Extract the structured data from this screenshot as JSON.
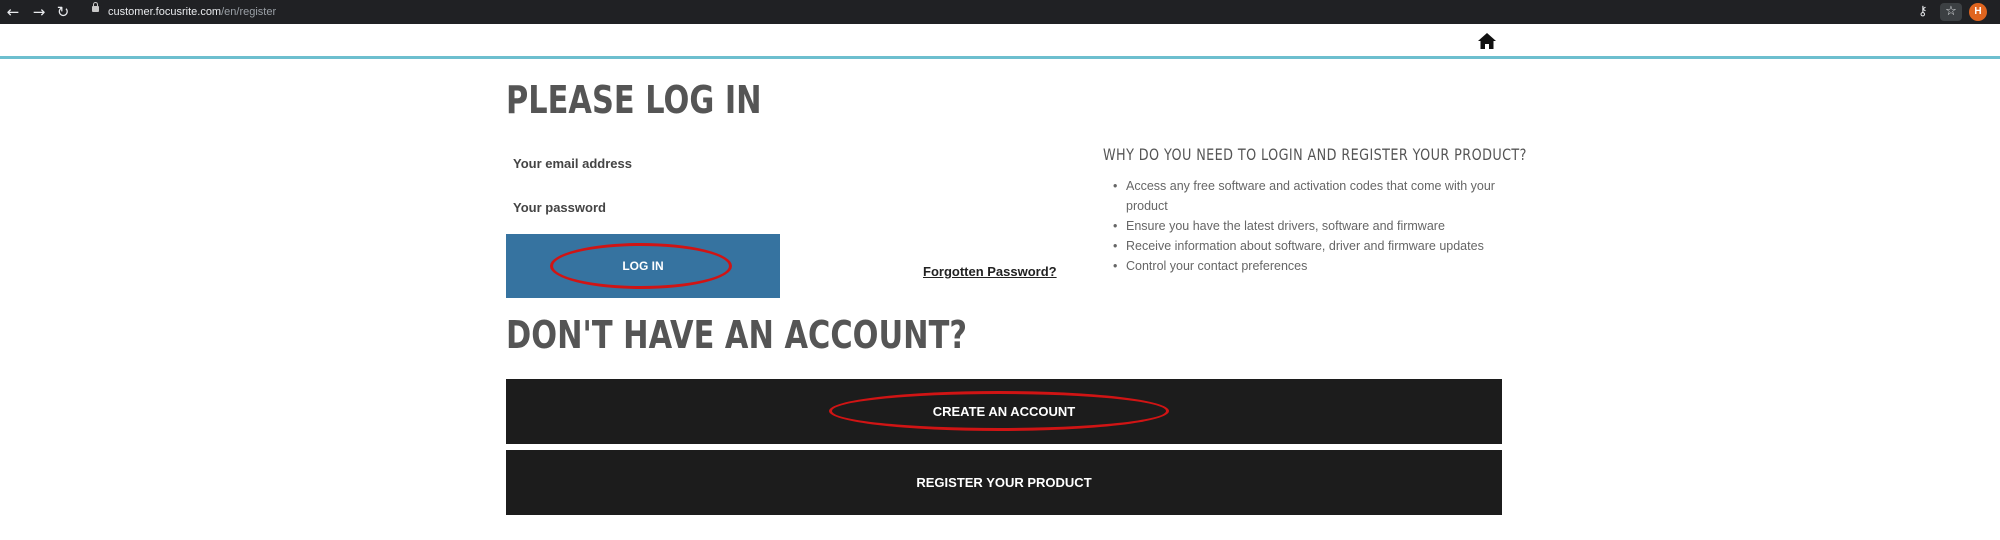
{
  "browser": {
    "url_host": "customer.focusrite.com",
    "url_path": "/en/register",
    "avatar_initial": "H",
    "icons": [
      "back-arrow-icon",
      "forward-arrow-icon",
      "reload-icon",
      "lock-icon",
      "key-icon",
      "star-icon"
    ]
  },
  "header": {
    "home_icon": "home-icon",
    "accent_color": "#6dbfcf"
  },
  "login": {
    "title": "PLEASE LOG IN",
    "email_label": "Your email address",
    "password_label": "Your password",
    "login_button": "LOG IN",
    "forgot_link": "Forgotten Password?",
    "button_color": "#3673a0"
  },
  "why": {
    "title": "WHY DO YOU NEED TO LOGIN AND REGISTER YOUR PRODUCT?",
    "reasons": [
      "Access any free software and activation codes that come with your product",
      "Ensure you have the latest drivers, software and firmware",
      "Receive information about software, driver and firmware updates",
      "Control your contact preferences"
    ]
  },
  "account": {
    "title": "DON'T HAVE AN ACCOUNT?",
    "create_button": "CREATE AN ACCOUNT",
    "register_button": "REGISTER YOUR PRODUCT",
    "button_color": "#1c1c1c"
  },
  "annotations": {
    "highlight_color": "#d01414"
  }
}
